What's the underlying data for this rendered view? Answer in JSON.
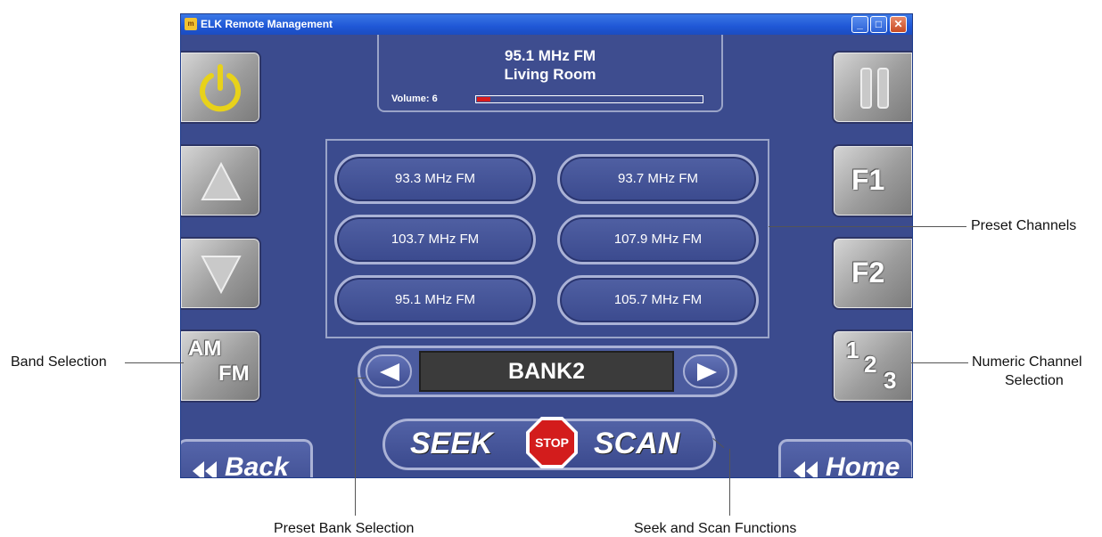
{
  "window": {
    "title": "ELK Remote Management",
    "icon_text": "m",
    "controls": {
      "minimize": "_",
      "maximize": "□",
      "close": "✕"
    }
  },
  "now_playing": {
    "frequency": "95.1 MHz FM",
    "room": "Living Room",
    "volume_label": "Volume: 6",
    "volume_fraction": 0.06
  },
  "presets": [
    "93.3 MHz FM",
    "93.7 MHz FM",
    "103.7 MHz FM",
    "107.9 MHz FM",
    "95.1 MHz FM",
    "105.7 MHz FM"
  ],
  "bank": {
    "label": "BANK2"
  },
  "seek_scan": {
    "seek": "SEEK",
    "stop": "STOP",
    "scan": "SCAN"
  },
  "left_buttons": {
    "band_am": "AM",
    "band_fm": "FM"
  },
  "right_buttons": {
    "f1": "F1",
    "f2": "F2",
    "num1": "1",
    "num2": "2",
    "num3": "3"
  },
  "nav": {
    "back": "Back",
    "home": "Home"
  },
  "callouts": {
    "band": "Band Selection",
    "preset_channels": "Preset Channels",
    "numeric_line1": "Numeric Channel",
    "numeric_line2": "Selection",
    "preset_bank": "Preset Bank Selection",
    "seek_scan": "Seek and Scan Functions"
  },
  "colors": {
    "panel": "#3b4b8e",
    "accent_red": "#d81b1b",
    "power_yellow": "#e8d21a"
  }
}
